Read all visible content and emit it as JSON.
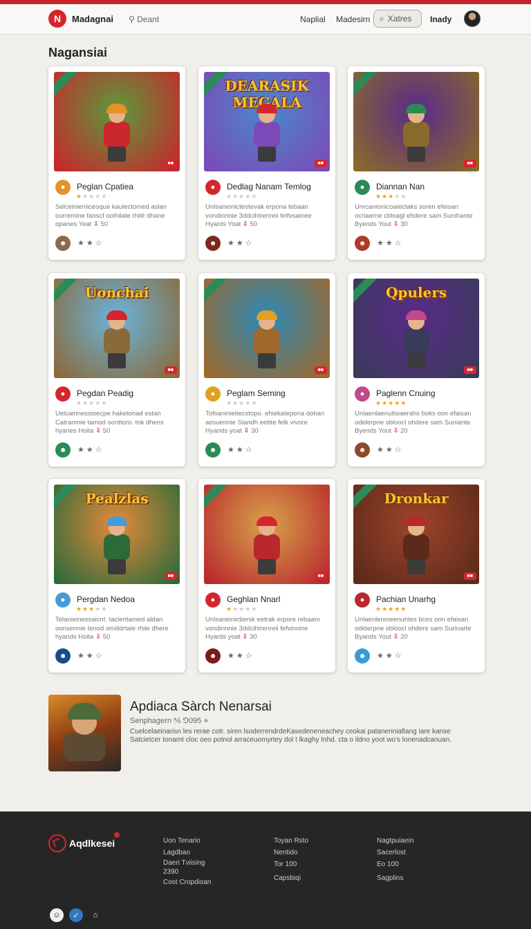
{
  "header": {
    "brand": "Madagnai",
    "sub": "Deant",
    "nav": [
      "Naplial",
      "Madesirn"
    ],
    "search_text": "Xatres",
    "user": "Inady"
  },
  "section_title": "Nagansiai",
  "cards": [
    {
      "name": "Peglan Cpatiea",
      "rating": 1,
      "desc": "Selceinieniiceoque kaulectomed aslan ourremine fanscf ooihilate rhilé dhane",
      "meta": "opanes Yeat",
      "meta_num": "50",
      "badge": "",
      "theme": "#5a9a3a",
      "accent": "#c9262d",
      "icon_color": "#e59325",
      "dev_color": "#8b6a4b",
      "title_art": ""
    },
    {
      "name": "Dedlag Nanam Temlog",
      "rating": 0,
      "desc": "Unlsanionicteotevak erpona tebaan vondinnnie 3ddcihtrenreii feifvsainee",
      "meta": "Hyards Yoat",
      "meta_num": "50",
      "badge": "",
      "theme": "#4a88c9",
      "accent": "#7b4ab8",
      "icon_color": "#d6262d",
      "dev_color": "#7a2a1a",
      "title_art": "DEARASIK MEGALA"
    },
    {
      "name": "Diannan Nan",
      "rating": 3,
      "desc": "Unrcanionicoaiectaks soren efeisan ocriaerne cbloagl ehdere sam Sunihante",
      "meta": "Byends Yout",
      "meta_num": "30",
      "badge": "",
      "theme": "#5a2a8a",
      "accent": "#8a6a2a",
      "icon_color": "#2c8a57",
      "dev_color": "#b03a2a",
      "title_art": ""
    },
    {
      "name": "Pegdan Peadig",
      "rating": 0,
      "desc": "Uelcainnessioecpe haketonad estan Catramnie tamod oonttoro. tnk dhens",
      "meta": "hyanes Hoita",
      "meta_num": "50",
      "badge": "",
      "theme": "#6ab4dd",
      "accent": "#8a6a3a",
      "icon_color": "#d6262d",
      "dev_color": "#2c8a57",
      "title_art": "Uonchai"
    },
    {
      "name": "Peglam Seming",
      "rating": 0,
      "desc": "Tofsaninietiecstopo. ehiekatepona dohan aosuennie Siandh eebte felk vivore",
      "meta": "Hyands yoat",
      "meta_num": "30",
      "badge": "",
      "theme": "#2a8ab8",
      "accent": "#a0682a",
      "icon_color": "#e0a020",
      "dev_color": "#2c8a57",
      "title_art": ""
    },
    {
      "name": "Paglenn Cnuing",
      "rating": 5,
      "desc": "Unlaenlaenuitsiaerahs boks oon efaisan odiderpne sbloocl ohdere sam Suniante",
      "meta": "Byends Yout",
      "meta_num": "20",
      "badge": "",
      "theme": "#5a2a8a",
      "accent": "#3a3a5a",
      "icon_color": "#c04a8a",
      "dev_color": "#8b4a2a",
      "title_art": "Qpulers"
    },
    {
      "name": "Pergdan Nedoa",
      "rating": 3,
      "desc": "Telanieinessaicnt. tacleritamed aldan oonsennie Ienod omilidrtale rhile dhere",
      "meta": "hyands Hoita",
      "meta_num": "50",
      "badge": "",
      "theme": "#e58a3a",
      "accent": "#2c6a3a",
      "icon_color": "#4a9ad8",
      "dev_color": "#1a4a8a",
      "title_art": "Pealzlas"
    },
    {
      "name": "Geghlan Nnarl",
      "rating": 1,
      "desc": "Unlsanionictiersk eetrak erpore rebaam vondinnnie 3ddcihtrenreii fefvinvine",
      "meta": "Hyards yoat",
      "meta_num": "30",
      "badge": "",
      "theme": "#d8a24a",
      "accent": "#b8282d",
      "icon_color": "#d6262d",
      "dev_color": "#7a1a1a",
      "title_art": ""
    },
    {
      "name": "Pachian Unarhg",
      "rating": 5,
      "desc": "Unlaenlenmeenuhtes bces oon efaisan odiderpne sbloocl ohdere sam Surinarte",
      "meta": "Byands Yout",
      "meta_num": "20",
      "badge": "",
      "theme": "#a0442a",
      "accent": "#5a2a1a",
      "icon_color": "#b8282d",
      "dev_color": "#3a9ad8",
      "title_art": "Dronkar"
    }
  ],
  "featured": {
    "title": "Apdiaca Sàrch Nenarsai",
    "sub": "Senphagern ⅍ ⅁095 ⋄",
    "desc": "Cuelcelaeinarisn les rerae cotr. siren lsoderrendrdeKasedeneneachey ceokai patanenniafiang iare kanse Satcietcer tonamt cloc oeo potnol arraceuomyrtey dol t lkaghy Inhd. cta o ildno yoot wo's lonenadcanuan."
  },
  "footer": {
    "brand": "Aqdlkesei",
    "col1": [
      "Uon Tenario",
      "Lagdbao",
      "Daeri Tviising",
      "2390",
      "Cost Cropdioan"
    ],
    "col2": [
      "Toyan Rsto",
      "Nentido",
      "Tor 100",
      "Capsbiqi"
    ],
    "col3": [
      "Nagtpuiaein",
      "Sacerlost",
      "Eo 100",
      "Sagplins"
    ]
  }
}
